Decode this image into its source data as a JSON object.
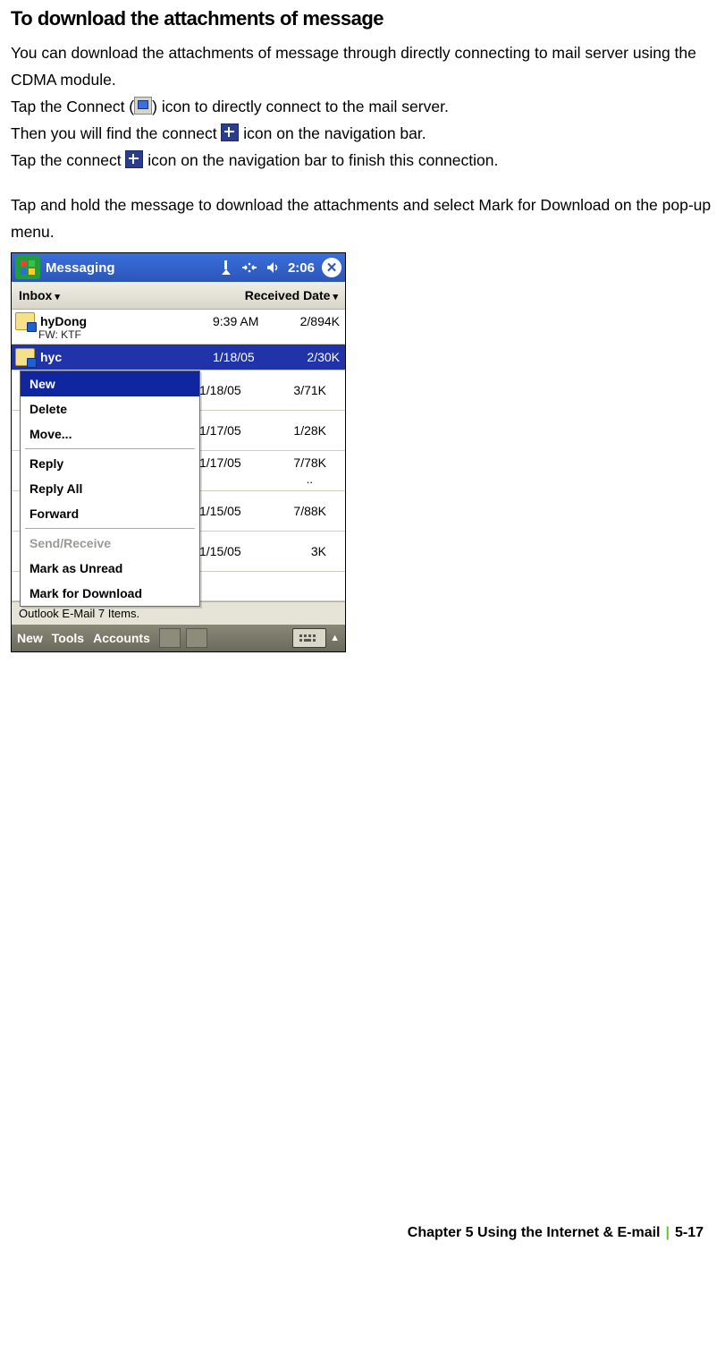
{
  "heading": "To download the attachments of message",
  "para1a": "You can download the attachments of message through directly connecting to mail server using the CDMA module.",
  "para2a": "Tap the Connect (",
  "para2b": ") icon to directly connect to the mail server.",
  "para3a": "Then you will find the connect ",
  "para3b": " icon on the navigation bar.",
  "para4a": "Tap the connect ",
  "para4b": " icon on the navigation bar to finish this connection.",
  "para5": "Tap and hold the message to download the attachments and select Mark for Download on the pop-up menu.",
  "titlebar": {
    "app": "Messaging",
    "time": "2:06"
  },
  "header": {
    "left": "Inbox",
    "right": "Received Date"
  },
  "first_msg": {
    "from": "hyDong",
    "time": "9:39 AM",
    "size": "2/894K",
    "subject": "FW: KTF"
  },
  "sel_msg": {
    "from": "hyc",
    "date": "1/18/05",
    "size": "2/30K"
  },
  "context": {
    "new": "New",
    "delete": "Delete",
    "move": "Move...",
    "reply": "Reply",
    "replyall": "Reply All",
    "forward": "Forward",
    "sendrecv": "Send/Receive",
    "markunread": "Mark as Unread",
    "markdl": "Mark for Download"
  },
  "rows": [
    {
      "date": "1/18/05",
      "size": "3/71K"
    },
    {
      "date": "1/17/05",
      "size": "1/28K"
    },
    {
      "date": "1/17/05",
      "size": "7/78K",
      "extra": ".."
    },
    {
      "date": "1/15/05",
      "size": "7/88K"
    },
    {
      "date": "1/15/05",
      "size": "3K"
    }
  ],
  "status": "Outlook E-Mail  7 Items.",
  "bottom": {
    "new": "New",
    "tools": "Tools",
    "accounts": "Accounts"
  },
  "footer": {
    "chapter": "Chapter 5 Using the Internet & E-mail",
    "page": "5-17"
  }
}
